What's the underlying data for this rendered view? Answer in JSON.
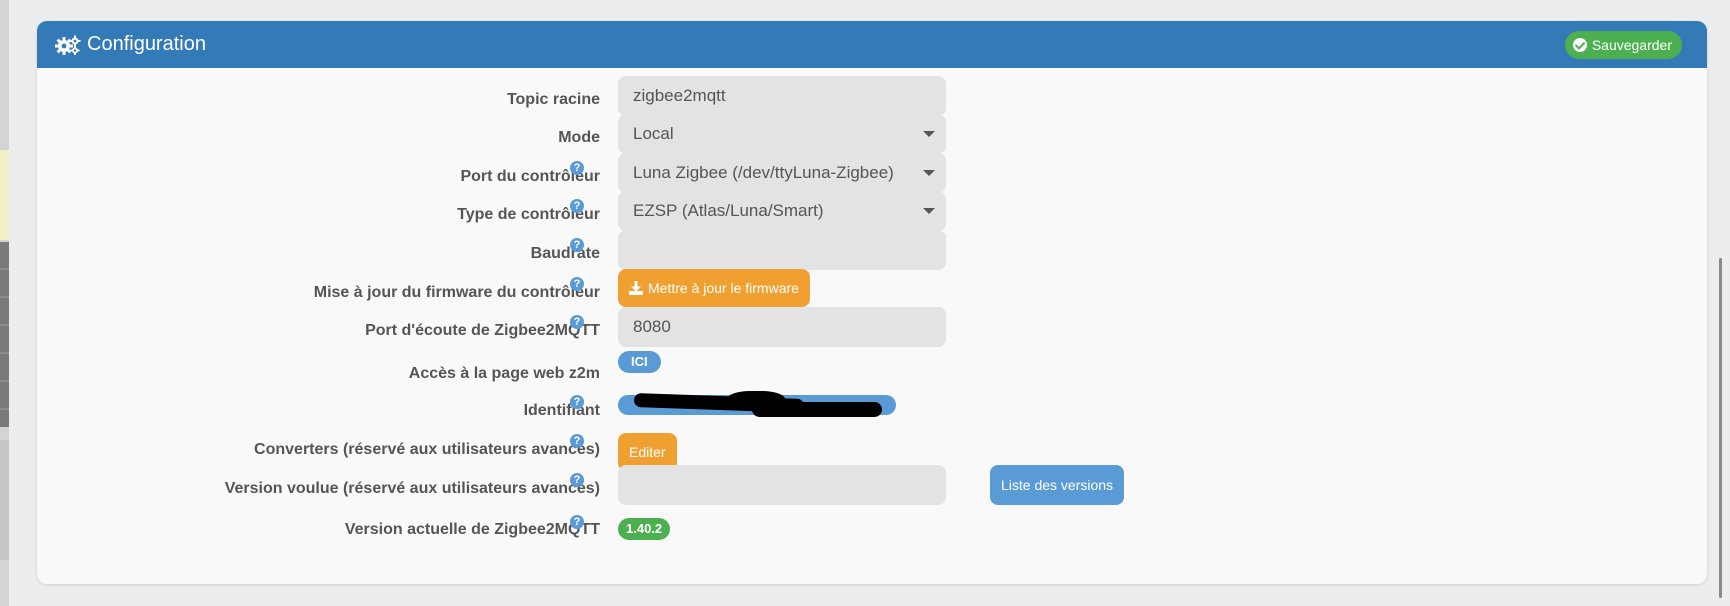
{
  "header": {
    "title": "Configuration",
    "save_label": "Sauvegarder",
    "header_color": "#337ab7"
  },
  "help_glyph": "?",
  "fields": {
    "topic_racine": {
      "label": "Topic racine",
      "value": "zigbee2mqtt"
    },
    "mode": {
      "label": "Mode",
      "value": "Local"
    },
    "port_controleur": {
      "label": "Port du contrôleur",
      "value": "Luna Zigbee (/dev/ttyLuna-Zigbee)"
    },
    "type_controleur": {
      "label": "Type de contrôleur",
      "value": "EZSP (Atlas/Luna/Smart)"
    },
    "baudrate": {
      "label": "Baudrate",
      "value": ""
    },
    "firmware": {
      "label": "Mise à jour du firmware du contrôleur",
      "button": "Mettre à jour le firmware"
    },
    "port_ecoute": {
      "label": "Port d'écoute de Zigbee2MQTT",
      "value": "8080"
    },
    "acces_web": {
      "label": "Accès à la page web z2m",
      "button": "ICI"
    },
    "identifiant": {
      "label": "Identifiant"
    },
    "converters": {
      "label": "Converters (réservé aux utilisateurs avancés)",
      "button": "Editer"
    },
    "version_voulue": {
      "label": "Version voulue (réservé aux utilisateurs avancés)",
      "value": "",
      "button": "Liste des versions"
    },
    "version_actuelle": {
      "label": "Version actuelle de Zigbee2MQTT",
      "value": "1.40.2"
    }
  }
}
